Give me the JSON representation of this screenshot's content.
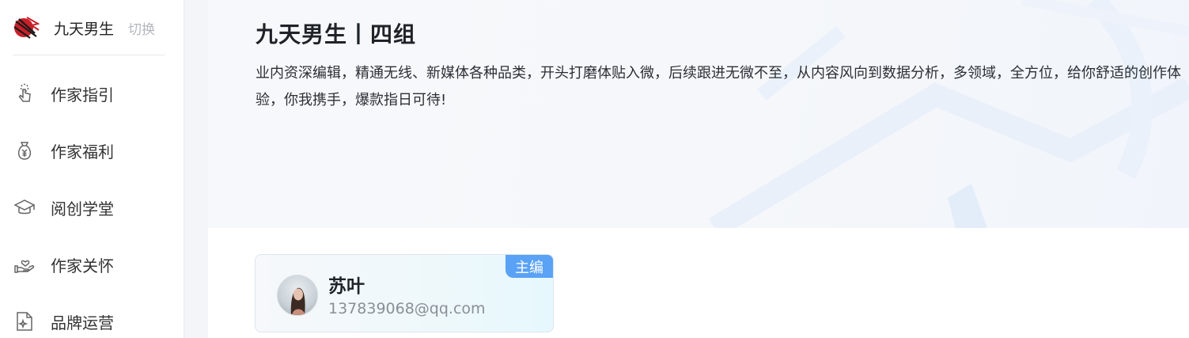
{
  "sidebar": {
    "brand_name": "九天男生",
    "switch_label": "切换",
    "items": [
      {
        "label": "作家指引",
        "icon": "touch-icon"
      },
      {
        "label": "作家福利",
        "icon": "money-bag-icon"
      },
      {
        "label": "阅创学堂",
        "icon": "graduation-cap-icon"
      },
      {
        "label": "作家关怀",
        "icon": "care-hand-icon"
      },
      {
        "label": "品牌运营",
        "icon": "document-sparkle-icon"
      }
    ]
  },
  "hero": {
    "title": "九天男生丨四组",
    "description": "业内资深编辑，精通无线、新媒体各种品类，开头打磨体贴入微，后续跟进无微不至，从内容风向到数据分析，多领域，全方位，给你舒适的创作体验，你我携手，爆款指日可待!"
  },
  "editor_card": {
    "name": "苏叶",
    "email": "137839068@qq.com",
    "role_badge": "主编"
  },
  "colors": {
    "accent_blue": "#5aa2f5",
    "logo_red": "#c8202a"
  }
}
